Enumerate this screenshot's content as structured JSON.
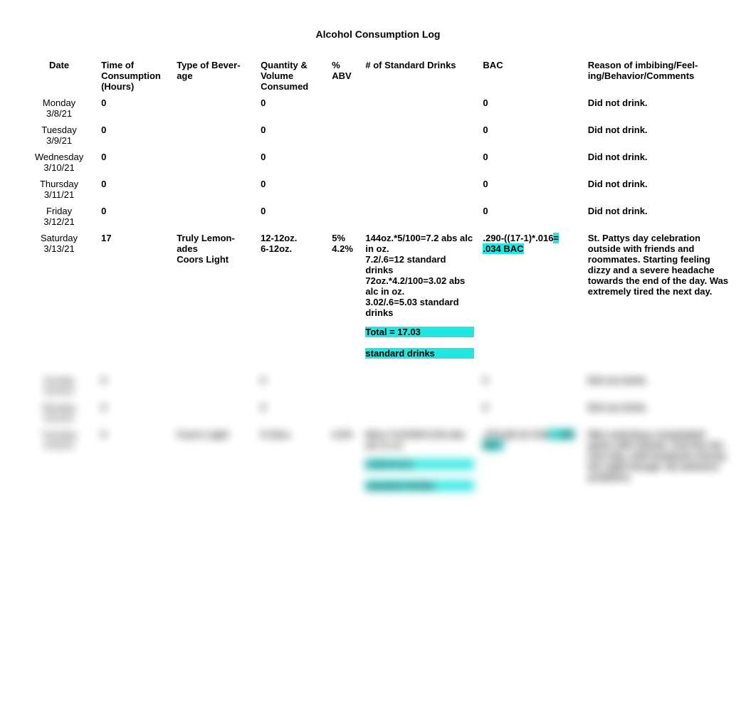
{
  "title": "Alcohol Consumption Log",
  "headers": {
    "date": "Date",
    "time": "Time of Consump­tion (Hours)",
    "bev": "Type of Bever­age",
    "qty": "Quantity & Volume Consumed",
    "abv": "% ABV",
    "std": "# of Standard Drinks",
    "bac": "BAC",
    "reason": "Reason of imbibing/Feel­ing/Behavior/Comments"
  },
  "rows": [
    {
      "day": "Monday",
      "date": "3/8/21",
      "time": "0",
      "bev": "",
      "qty": "0",
      "abv": "",
      "std": "",
      "bac": "0",
      "reason": "Did not drink."
    },
    {
      "day": "Tuesday",
      "date": "3/9/21",
      "time": "0",
      "bev": "",
      "qty": "0",
      "abv": "",
      "std": "",
      "bac": "0",
      "reason": "Did not drink."
    },
    {
      "day": "Wednesday",
      "date": "3/10/21",
      "time": "0",
      "bev": "",
      "qty": "0",
      "abv": "",
      "std": "",
      "bac": "0",
      "reason": "Did not drink."
    },
    {
      "day": "Thursday",
      "date": "3/11/21",
      "time": "0",
      "bev": "",
      "qty": "0",
      "abv": "",
      "std": "",
      "bac": "0",
      "reason": "Did not drink."
    },
    {
      "day": "Friday",
      "date": "3/12/21",
      "time": "0",
      "bev": "",
      "qty": "0",
      "abv": "",
      "std": "",
      "bac": "0",
      "reason": "Did not drink."
    },
    {
      "day": "Saturday",
      "date": "3/13/21",
      "time": "17",
      "bev_lines": [
        "Truly Lemon­ades",
        "Coors Light"
      ],
      "qty_lines": [
        "12-12oz.",
        "6-12oz."
      ],
      "abv_lines": [
        "5%",
        "4.2%"
      ],
      "std_lines": [
        "144oz.*5/100=7.2 abs alc in oz.",
        "7.2/.6=12 standard drinks",
        "72oz.*4.2/100=3.02 abs alc in oz.",
        "3.02/.6=5.03 standard drinks"
      ],
      "std_total_lines": [
        "Total = 17.03",
        "standard drinks"
      ],
      "bac_prefix": ".290-((17-1)*.016",
      "bac_highlight": "= .034 BAC",
      "reason": "St. Pattys day celebration outside with friends and roommates. Starting feeling dizzy and a severe headache towards the end of the day. Was extremely tired the next day."
    }
  ],
  "blurred_rows": [
    {
      "day": "Sunday",
      "date": "3/14/21",
      "time": "0",
      "bev": "",
      "qty": "0",
      "abv": "",
      "std": "",
      "bac": "0",
      "reason": "Did not drink."
    },
    {
      "day": "Monday",
      "date": "3/15/21",
      "time": "0",
      "bev": "",
      "qty": "0",
      "abv": "",
      "std": "",
      "bac": "0",
      "reason": "Did not drink."
    },
    {
      "day": "Tuesday",
      "date": "3/16/21",
      "time": "5",
      "bev": "Coors Light",
      "qty": "5-12oz.",
      "abv": "4.2%",
      "std_lines": [
        "60oz.*4.2/100=2.52 abs alc in oz."
      ],
      "std_total_lines": [
        "2.52/.6=4.2",
        "standard drinks"
      ],
      "bac_prefix": ".072-((5-1)*.016",
      "bac_highlight": "= .008 BAC",
      "reason": "Was watching a basketball game with friends. Felt fine the next day, mild headache during the night though. No behavior problems."
    }
  ]
}
